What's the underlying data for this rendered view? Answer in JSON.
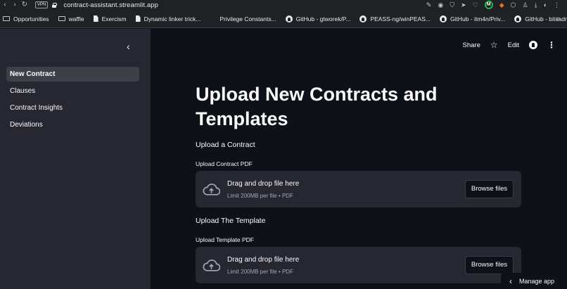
{
  "browser": {
    "vpn_label": "VPN",
    "url_host": "contract-assistant.streamlit.app"
  },
  "bookmarks": [
    {
      "label": "Opportunities",
      "icon": "folder-icon"
    },
    {
      "label": "waffle",
      "icon": "folder-icon"
    },
    {
      "label": "Exercism",
      "icon": "page-icon"
    },
    {
      "label": "Dynamic linker trick...",
      "icon": "page-icon"
    },
    {
      "label": "Privilege Constants...",
      "icon": "microsoft-icon"
    },
    {
      "label": "GitHub - gtworek/P...",
      "icon": "github-icon"
    },
    {
      "label": "PEASS-ng/winPEAS...",
      "icon": "github-icon"
    },
    {
      "label": "GitHub - itm4n/Priv...",
      "icon": "github-icon"
    },
    {
      "label": "GitHub - bitsadmin/...",
      "icon": "github-icon"
    }
  ],
  "sidebar": {
    "items": [
      {
        "label": "New Contract",
        "active": true
      },
      {
        "label": "Clauses",
        "active": false
      },
      {
        "label": "Contract Insights",
        "active": false
      },
      {
        "label": "Deviations",
        "active": false
      }
    ]
  },
  "header": {
    "share_label": "Share",
    "edit_label": "Edit"
  },
  "main": {
    "title": "Upload New Contracts and Templates",
    "section1": {
      "heading": "Upload a Contract",
      "uploader_label": "Upload Contract PDF",
      "dropzone_text": "Drag and drop file here",
      "dropzone_limit": "Limit 200MB per file • PDF",
      "browse_label": "Browse files"
    },
    "section2": {
      "heading": "Upload The Template",
      "uploader_label": "Upload Template PDF",
      "dropzone_text": "Drag and drop file here",
      "dropzone_limit": "Limit 200MB per file • PDF",
      "browse_label": "Browse files"
    }
  },
  "footer": {
    "manage_label": "Manage app"
  },
  "colors": {
    "background": "#0e1117",
    "sidebar": "#262730",
    "text": "#fafafa"
  }
}
